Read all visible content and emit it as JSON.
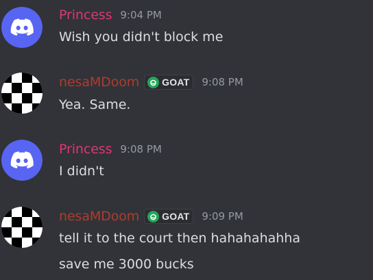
{
  "messages": [
    {
      "username": "Princess",
      "avatar_icon": "discord-logo-icon",
      "time": "9:04 PM",
      "lines": [
        "Wish you didn't block me"
      ]
    },
    {
      "username": "nesaMDoom",
      "avatar_icon": "checker-avatar-icon",
      "tag": "GOAT",
      "time": "9:08 PM",
      "lines": [
        "Yea. Same."
      ]
    },
    {
      "username": "Princess",
      "avatar_icon": "discord-logo-icon",
      "time": "9:08 PM",
      "lines": [
        "I didn't"
      ]
    },
    {
      "username": "nesaMDoom",
      "avatar_icon": "checker-avatar-icon",
      "tag": "GOAT",
      "time": "9:09 PM",
      "lines": [
        "tell it to the court then hahahahahha",
        "save me 3000 bucks"
      ]
    }
  ],
  "colors": {
    "background": "#313338",
    "princess_name": "#e0366f",
    "nesa_name": "#b23a2c",
    "discord_blurple": "#5865f2",
    "timestamp": "#949ba4",
    "message_text": "#dbdee1",
    "tag_icon_green": "#23a55a"
  }
}
